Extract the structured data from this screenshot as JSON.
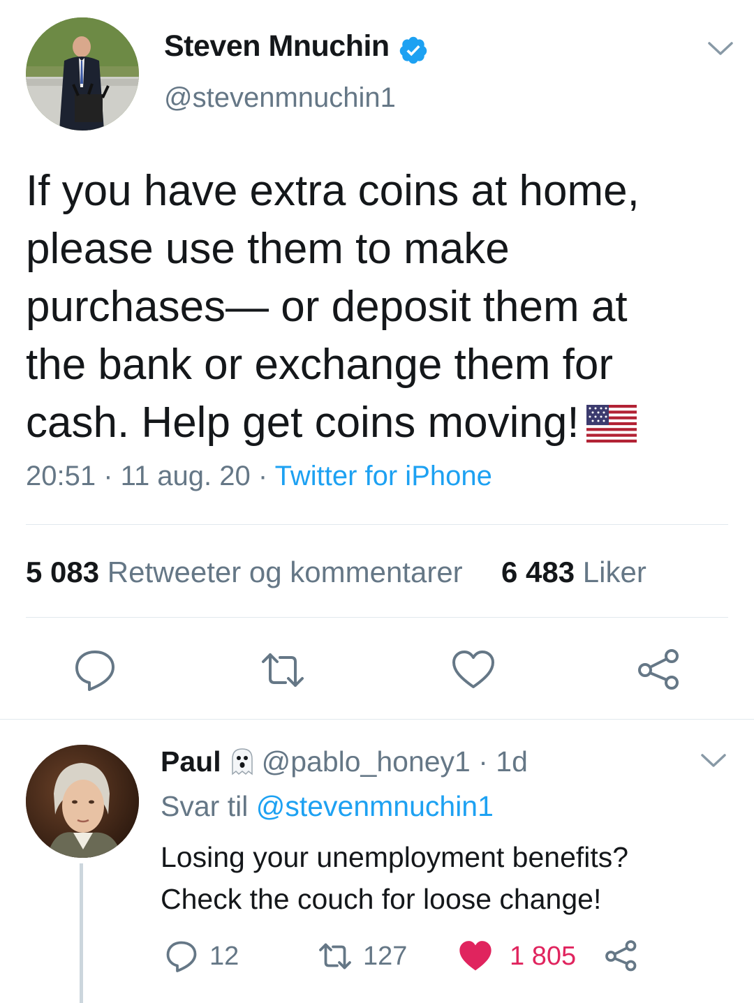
{
  "tweet": {
    "author": {
      "name": "Steven Mnuchin",
      "handle": "@stevenmnuchin1",
      "verified": true
    },
    "text": "If you have extra coins at home,\nplease use them to make\npurchases— or deposit them at\nthe bank or exchange them for\ncash. Help get coins moving!",
    "emoji": "us-flag-emoji",
    "time": "20:51",
    "date": "11 aug. 20",
    "source": "Twitter for iPhone",
    "retweets_count": "5 083",
    "retweets_label": "Retweeter og kommentarer",
    "likes_count": "6 483",
    "likes_label": "Liker",
    "actions": [
      "reply-icon",
      "retweet-icon",
      "like-icon",
      "share-icon"
    ]
  },
  "reply": {
    "author": {
      "name": "Paul",
      "emoji": "ghost-emoji",
      "handle": "@pablo_honey1",
      "age": "1d"
    },
    "reply_to_label": "Svar til",
    "reply_to_handle": "@stevenmnuchin1",
    "text": "Losing your unemployment benefits?\nCheck the couch for loose change!",
    "replies": "12",
    "retweets": "127",
    "likes": "1 805",
    "liked": true
  },
  "colors": {
    "text": "#14171a",
    "secondary": "#657786",
    "link": "#1da1f2",
    "verified": "#1da1f2",
    "like": "#e0245e",
    "divider": "#e1e8ed"
  }
}
